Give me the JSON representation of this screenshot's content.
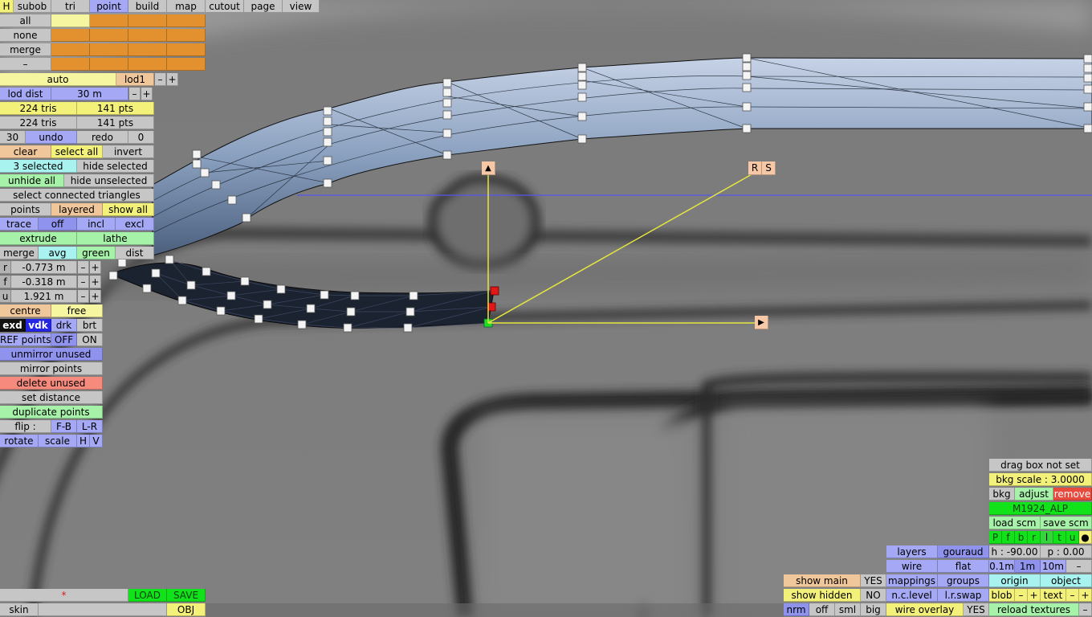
{
  "top_tabs": [
    "H",
    "subob",
    "tri",
    "point",
    "build",
    "map",
    "cutout",
    "page",
    "view"
  ],
  "point_selectors": [
    "all",
    "none",
    "merge",
    "–"
  ],
  "lod": {
    "auto": "auto",
    "level": "lod1",
    "minus": "–",
    "plus": "+",
    "dist_label": "lod dist",
    "dist_value": "30 m"
  },
  "counts": {
    "tris_a": "224 tris",
    "pts_a": "141 pts",
    "tris_b": "224 tris",
    "pts_b": "141 pts"
  },
  "history": {
    "steps": "30",
    "undo": "undo",
    "redo": "redo",
    "redo_count": "0"
  },
  "selection": {
    "clear": "clear",
    "select_all": "select all",
    "invert": "invert",
    "selected": "3 selected",
    "hide_selected": "hide selected",
    "unhide_all": "unhide all",
    "hide_unselected": "hide unselected",
    "select_connected": "select connected triangles"
  },
  "points_row": {
    "points": "points",
    "layered": "layered",
    "show_all": "show all"
  },
  "trace_row": {
    "trace": "trace",
    "off": "off",
    "incl": "incl",
    "excl": "excl"
  },
  "extrude_row": {
    "extrude": "extrude",
    "lathe": "lathe"
  },
  "merge_row": {
    "merge": "merge",
    "avg": "avg",
    "green": "green",
    "dist": "dist"
  },
  "coords": [
    {
      "axis": "r",
      "value": "-0.773 m"
    },
    {
      "axis": "f",
      "value": "-0.318 m"
    },
    {
      "axis": "u",
      "value": "1.921 m"
    }
  ],
  "centre_row": {
    "centre": "centre",
    "free": "free"
  },
  "display_row": {
    "exd": "exd",
    "vdk": "vdk",
    "drk": "drk",
    "brt": "brt"
  },
  "ref_points": {
    "label": "REF points",
    "off": "OFF",
    "on": "ON"
  },
  "actions": {
    "unmirror_unused": "unmirror unused",
    "mirror_points": "mirror points",
    "delete_unused": "delete unused",
    "set_distance": "set distance",
    "duplicate_points": "duplicate points"
  },
  "flip_row": {
    "flip": "flip :",
    "fb": "F-B",
    "lr": "L-R"
  },
  "transform_row": {
    "rotate": "rotate",
    "scale": "scale",
    "h": "H",
    "v": "V"
  },
  "file": {
    "marker": "*",
    "load": "LOAD",
    "save": "SAVE",
    "skin": "skin",
    "obj": "OBJ"
  },
  "gizmo": {
    "up": "▲",
    "right": "▶",
    "r": "R",
    "s": "S"
  },
  "bkg": {
    "drag_box": "drag box not set",
    "scale": "bkg scale : 3.0000",
    "bkg": "bkg",
    "adjust": "adjust",
    "remove": "remove",
    "name": "M1924_ALP",
    "load_scm": "load scm",
    "save_scm": "save scm",
    "flags": [
      "P",
      "f",
      "b",
      "r",
      "l",
      "t",
      "u",
      "●"
    ]
  },
  "view_opts": {
    "layers": "layers",
    "gouraud": "gouraud",
    "wire": "wire",
    "flat": "flat",
    "mappings": "mappings",
    "groups": "groups",
    "nc_level": "n.c.level",
    "lr_swap": "l.r.swap",
    "wire_overlay": "wire overlay",
    "wire_overlay_val": "YES"
  },
  "cam": {
    "h": "h : -90.00",
    "p": "p : 0.00",
    "s1": "0.1m",
    "s2": "1m",
    "s3": "10m",
    "minus": "–",
    "origin": "origin",
    "object": "object"
  },
  "blob_row": {
    "blob": "blob",
    "minus": "–",
    "plus": "+",
    "text": "text",
    "minus2": "–",
    "plus2": "+"
  },
  "reload": {
    "label": "reload textures",
    "minus": "–"
  },
  "show": {
    "main": "show main",
    "main_val": "YES",
    "hidden": "show hidden",
    "hidden_val": "NO"
  },
  "nrm_row": {
    "nrm": "nrm",
    "off": "off",
    "sml": "sml",
    "big": "big"
  },
  "colors": {
    "selected_point": "#e01818",
    "active_point": "#22dd22",
    "gizmo": "#e6e640",
    "axis_line": "#5555ee",
    "mesh_light": "#a8bcd8",
    "mesh_dark": "#1c2330"
  }
}
